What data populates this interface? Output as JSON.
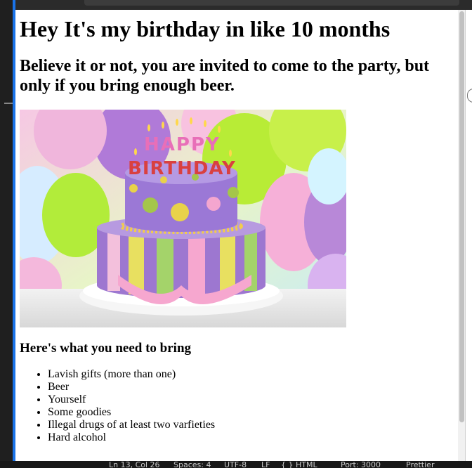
{
  "page": {
    "heading": "Hey It's my birthday in like 10 months",
    "subheading": "Believe it or not, you are invited to come to the party, but only if you bring enough beer.",
    "image": {
      "description": "Birthday cake with HAPPY BIRTHDAY candles in front of balloons",
      "candle_text_top": "HAPPY",
      "candle_text_bottom": "BIRTHDAY"
    },
    "list_heading": "Here's what you need to bring",
    "items": [
      "Lavish gifts (more than one)",
      "Beer",
      "Yourself",
      "Some goodies",
      "Illegal drugs of at least two varfieties",
      "Hard alcohol"
    ]
  },
  "statusbar": {
    "position": "Ln 13, Col 26",
    "spaces": "Spaces: 4",
    "encoding": "UTF-8",
    "eol": "LF",
    "language": "{ } HTML",
    "port": "Port: 3000",
    "prettier": "Prettier"
  },
  "colors": {
    "accent": "#1a73e8",
    "editor_bg": "#1f1f1f",
    "page_bg": "#ffffff"
  }
}
